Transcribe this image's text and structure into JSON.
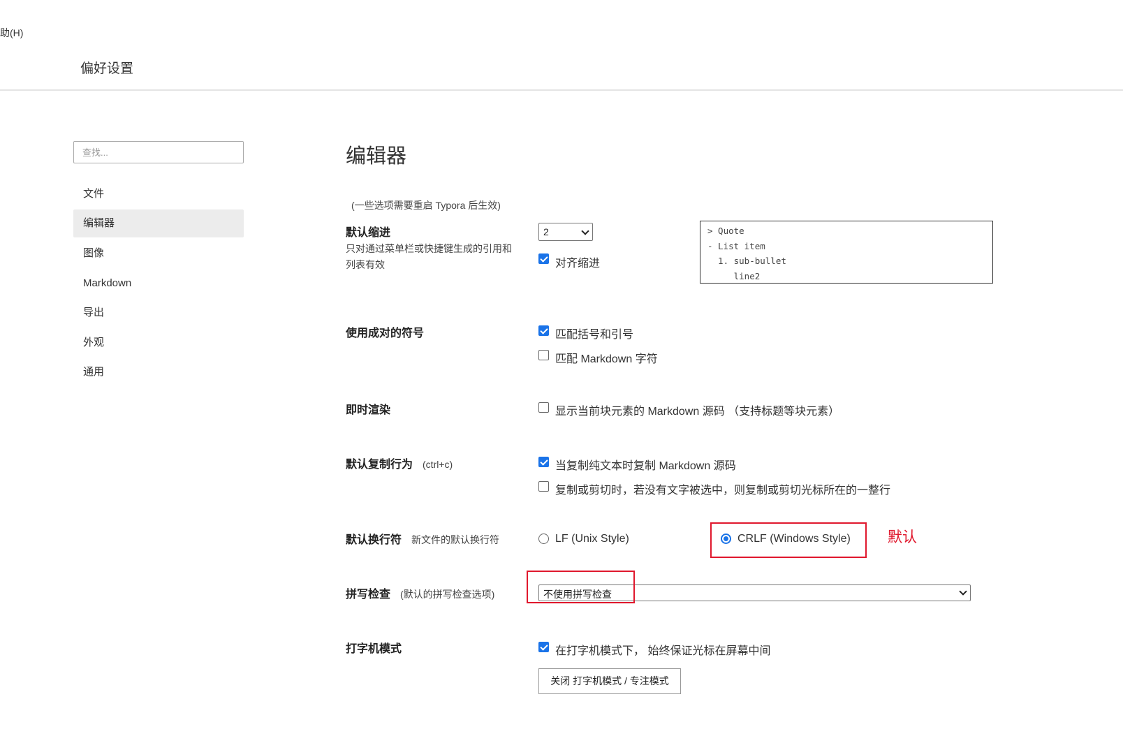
{
  "window": {
    "menu_fragment": "助(H)",
    "title": "偏好设置"
  },
  "sidebar": {
    "search_placeholder": "查找...",
    "items": [
      {
        "label": "文件"
      },
      {
        "label": "编辑器"
      },
      {
        "label": "图像"
      },
      {
        "label": "Markdown"
      },
      {
        "label": "导出"
      },
      {
        "label": "外观"
      },
      {
        "label": "通用"
      }
    ]
  },
  "main": {
    "title": "编辑器",
    "restart_note": "(一些选项需要重启 Typora 后生效)",
    "indent": {
      "label": "默认缩进",
      "desc": "只对通过菜单栏或快捷键生成的引用和列表有效",
      "value": "2",
      "align_label": "对齐缩进",
      "align_checked": true,
      "preview_lines": [
        "> Quote",
        "- List item",
        "  1. sub-bullet",
        "     line2"
      ]
    },
    "pairs": {
      "label": "使用成对的符号",
      "options": [
        {
          "label": "匹配括号和引号",
          "checked": true
        },
        {
          "label": "匹配 Markdown 字符",
          "checked": false
        }
      ]
    },
    "live_render": {
      "label": "即时渲染",
      "option": {
        "label": "显示当前块元素的 Markdown 源码 （支持标题等块元素）",
        "checked": false
      }
    },
    "copy": {
      "label": "默认复制行为",
      "sub": "(ctrl+c)",
      "options": [
        {
          "label": "当复制纯文本时复制 Markdown 源码",
          "checked": true
        },
        {
          "label": "复制或剪切时，若没有文字被选中，则复制或剪切光标所在的一整行",
          "checked": false
        }
      ]
    },
    "line_ending": {
      "label": "默认换行符",
      "sub": "新文件的默认换行符",
      "options": [
        {
          "label": "LF (Unix Style)",
          "selected": false
        },
        {
          "label": "CRLF (Windows Style)",
          "selected": true
        }
      ],
      "annotation": "默认"
    },
    "spellcheck": {
      "label": "拼写检查",
      "sub": "(默认的拼写检查选项)",
      "value": "不使用拼写检查"
    },
    "typewriter": {
      "label": "打字机模式",
      "option": {
        "label": "在打字机模式下， 始终保证光标在屏幕中间",
        "checked": true
      },
      "button": "关闭 打字机模式 / 专注模式"
    }
  },
  "colors": {
    "accent": "#1a73e8",
    "annotation_red": "#e0182d",
    "active_nav_bg": "#ececec"
  }
}
